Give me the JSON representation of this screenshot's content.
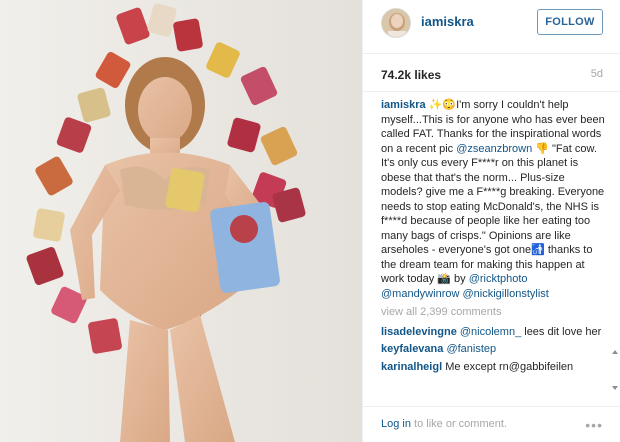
{
  "post": {
    "username": "iamiskra",
    "follow_label": "FOLLOW",
    "likes": "74.2k likes",
    "age": "5d"
  },
  "caption": {
    "username": "iamiskra",
    "t1": " ✨😳I'm sorry I couldn't help myself...This is for anyone who has ever been called FAT. Thanks for the inspirational words on a recent pic ",
    "m1": "@zseanzbrown",
    "t2": " 👎 \"Fat cow. It's only cus every F****r on this planet is obese that that's the norm... Plus-size models? give me a F****g breaking. Everyone needs to stop eating McDonald's, the NHS is f****d because of people like her eating too many bags of crisps.\" Opinions are like arseholes - everyone's got one🚮 thanks to the dream team for making this happen at work today 📸 by ",
    "m2": "@ricktphoto",
    "m3": "@mandywinrow",
    "m4": "@nickigillonstylist"
  },
  "view_all": "view all 2,399 comments",
  "comments": [
    {
      "user": "lisadelevingne",
      "mention": "@nicolemn_",
      "text": " lees dit love her"
    },
    {
      "user": "keyfalevana",
      "mention": "@fanistep",
      "text": ""
    },
    {
      "user": "karinalheigl",
      "mention": "",
      "text": "Me except rn@gabbifeilen"
    }
  ],
  "footer": {
    "login": "Log in",
    "rest": " to like or comment.",
    "more": "•••"
  },
  "icons": {
    "avatar": "avatar",
    "more": "more-options-icon"
  },
  "colors": {
    "link": "#125688",
    "follow_border": "#6f97b6",
    "muted": "#a5a7aa"
  }
}
